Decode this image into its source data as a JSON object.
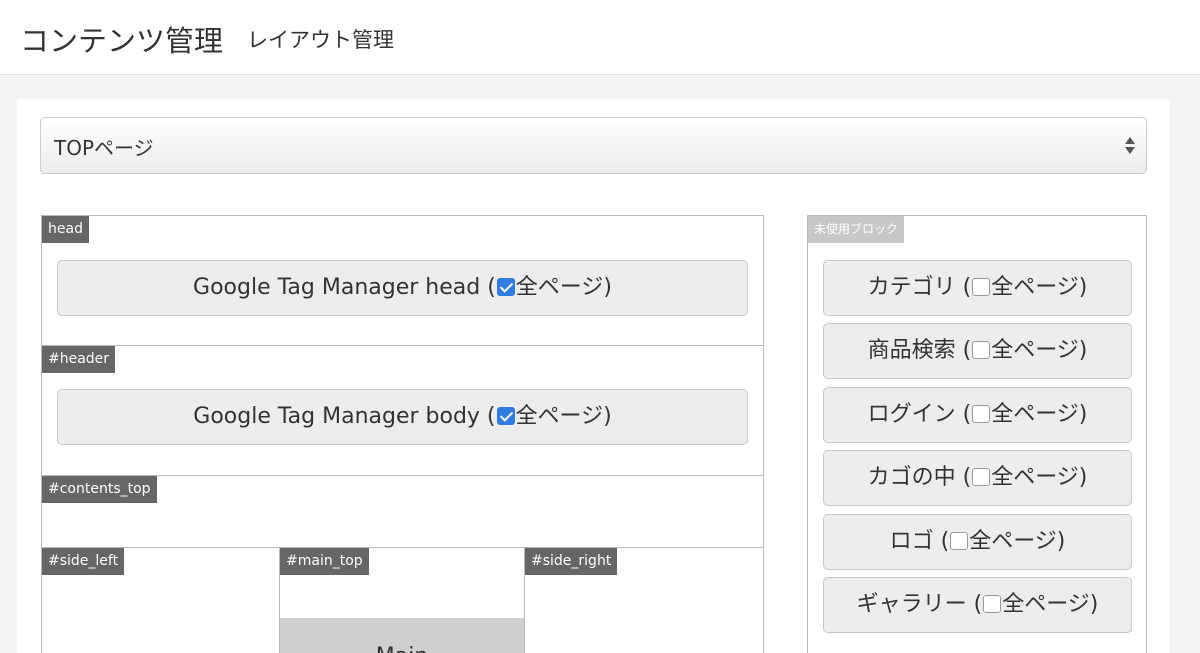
{
  "header": {
    "title": "コンテンツ管理",
    "subtitle": "レイアウト管理"
  },
  "page_select": {
    "value": "TOPページ"
  },
  "regions": {
    "head": {
      "tag": "head",
      "block_name": "Google Tag Manager head (",
      "block_all": "全ページ)",
      "checked": true
    },
    "header": {
      "tag": "#header",
      "block_name": "Google Tag Manager body (",
      "block_all": "全ページ)",
      "checked": true
    },
    "contents_top": {
      "tag": "#contents_top"
    },
    "side_left": {
      "tag": "#side_left"
    },
    "main_top": {
      "tag": "#main_top"
    },
    "main": {
      "label": "Main"
    },
    "side_right": {
      "tag": "#side_right"
    }
  },
  "unused": {
    "tag": "未使用ブロック",
    "blocks": [
      {
        "name": "カテゴリ (",
        "all": "全ページ)",
        "checked": false
      },
      {
        "name": "商品検索 (",
        "all": "全ページ)",
        "checked": false
      },
      {
        "name": "ログイン (",
        "all": "全ページ)",
        "checked": false
      },
      {
        "name": "カゴの中 (",
        "all": "全ページ)",
        "checked": false
      },
      {
        "name": "ロゴ (",
        "all": "全ページ)",
        "checked": false
      },
      {
        "name": "ギャラリー (",
        "all": "全ページ)",
        "checked": false
      }
    ]
  },
  "colors": {
    "accent": "#2f7de1",
    "tag_bg": "#666666",
    "block_bg": "#ededed"
  }
}
